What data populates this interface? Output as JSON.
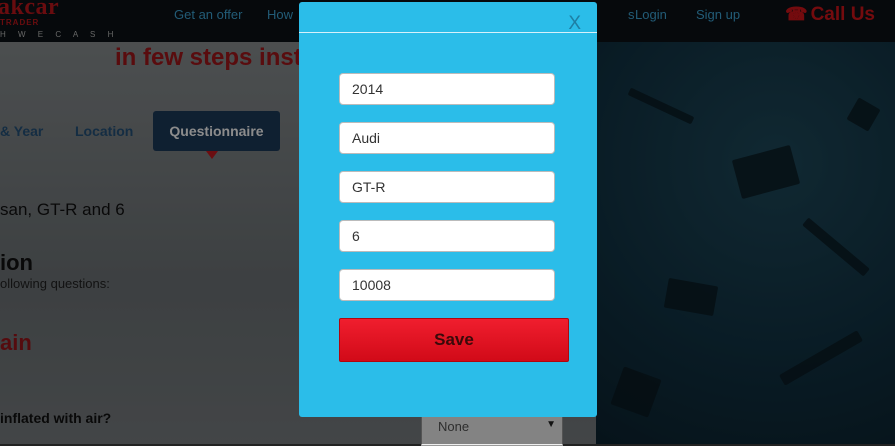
{
  "header": {
    "logo_main": "akcar",
    "logo_sub": "TRADER",
    "logo_tag": "H  W E  C A S H",
    "nav": [
      {
        "label": "Get an offer"
      },
      {
        "label": "How"
      },
      {
        "label": "s"
      },
      {
        "label": "Login"
      },
      {
        "label": "Sign up"
      }
    ],
    "call_us": "Call Us",
    "phone_icon": "phone-icon"
  },
  "page": {
    "headline": "in few steps inst",
    "steps": [
      {
        "label": "& Year"
      },
      {
        "label": "Location"
      },
      {
        "label": "Questionnaire"
      }
    ],
    "vehicle_summary": "san, GT-R and 6",
    "section_title": "ion",
    "section_sub": "ollowing questions:",
    "section_heading": "ain",
    "question": "inflated with air?",
    "question_select": {
      "value": "None"
    }
  },
  "modal": {
    "close_label": "X",
    "fields": [
      {
        "value": "2014"
      },
      {
        "value": "Audi"
      },
      {
        "value": "GT-R"
      },
      {
        "value": "6"
      },
      {
        "value": "10008"
      }
    ],
    "save_label": "Save"
  },
  "colors": {
    "brand_red": "#c0171d",
    "modal_blue": "#2bbde9",
    "nav_blue": "#3ea6d8",
    "save_red": "#e01422"
  }
}
